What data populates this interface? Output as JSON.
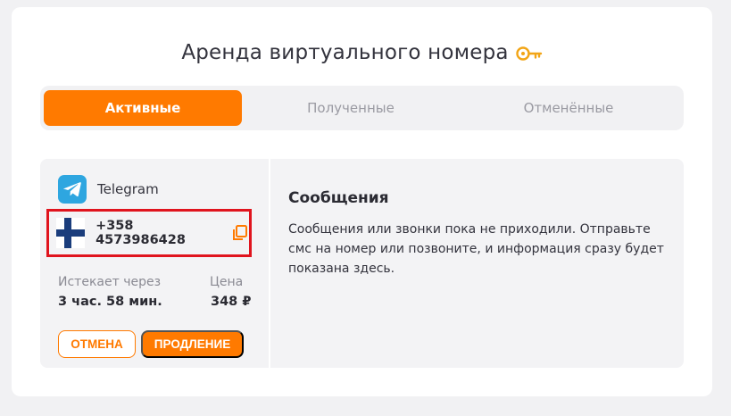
{
  "header": {
    "title": "Аренда виртуального номера",
    "title_icon": "key-icon"
  },
  "tabs": [
    {
      "label": "Активные",
      "active": true
    },
    {
      "label": "Полученные",
      "active": false
    },
    {
      "label": "Отменённые",
      "active": false
    }
  ],
  "rental": {
    "service": {
      "name": "Telegram",
      "icon": "telegram-icon"
    },
    "country_flag": "finland-flag-icon",
    "phone_number": "+358 4573986428",
    "expires_label": "Истекает через",
    "expires_value": "3 час. 58 мин.",
    "price_label": "Цена",
    "price_value": "348 ₽",
    "cancel_label": "ОТМЕНА",
    "extend_label": "ПРОДЛЕНИЕ"
  },
  "messages": {
    "title": "Сообщения",
    "text": "Сообщения или звонки пока не приходили. Отправьте смс на номер или позвоните, и информация сразу будет показана здесь."
  },
  "colors": {
    "accent": "#ff7a00",
    "highlight_border": "#e0141e",
    "telegram_blue": "#2ea6e0",
    "flag_blue": "#1a3d7c"
  }
}
